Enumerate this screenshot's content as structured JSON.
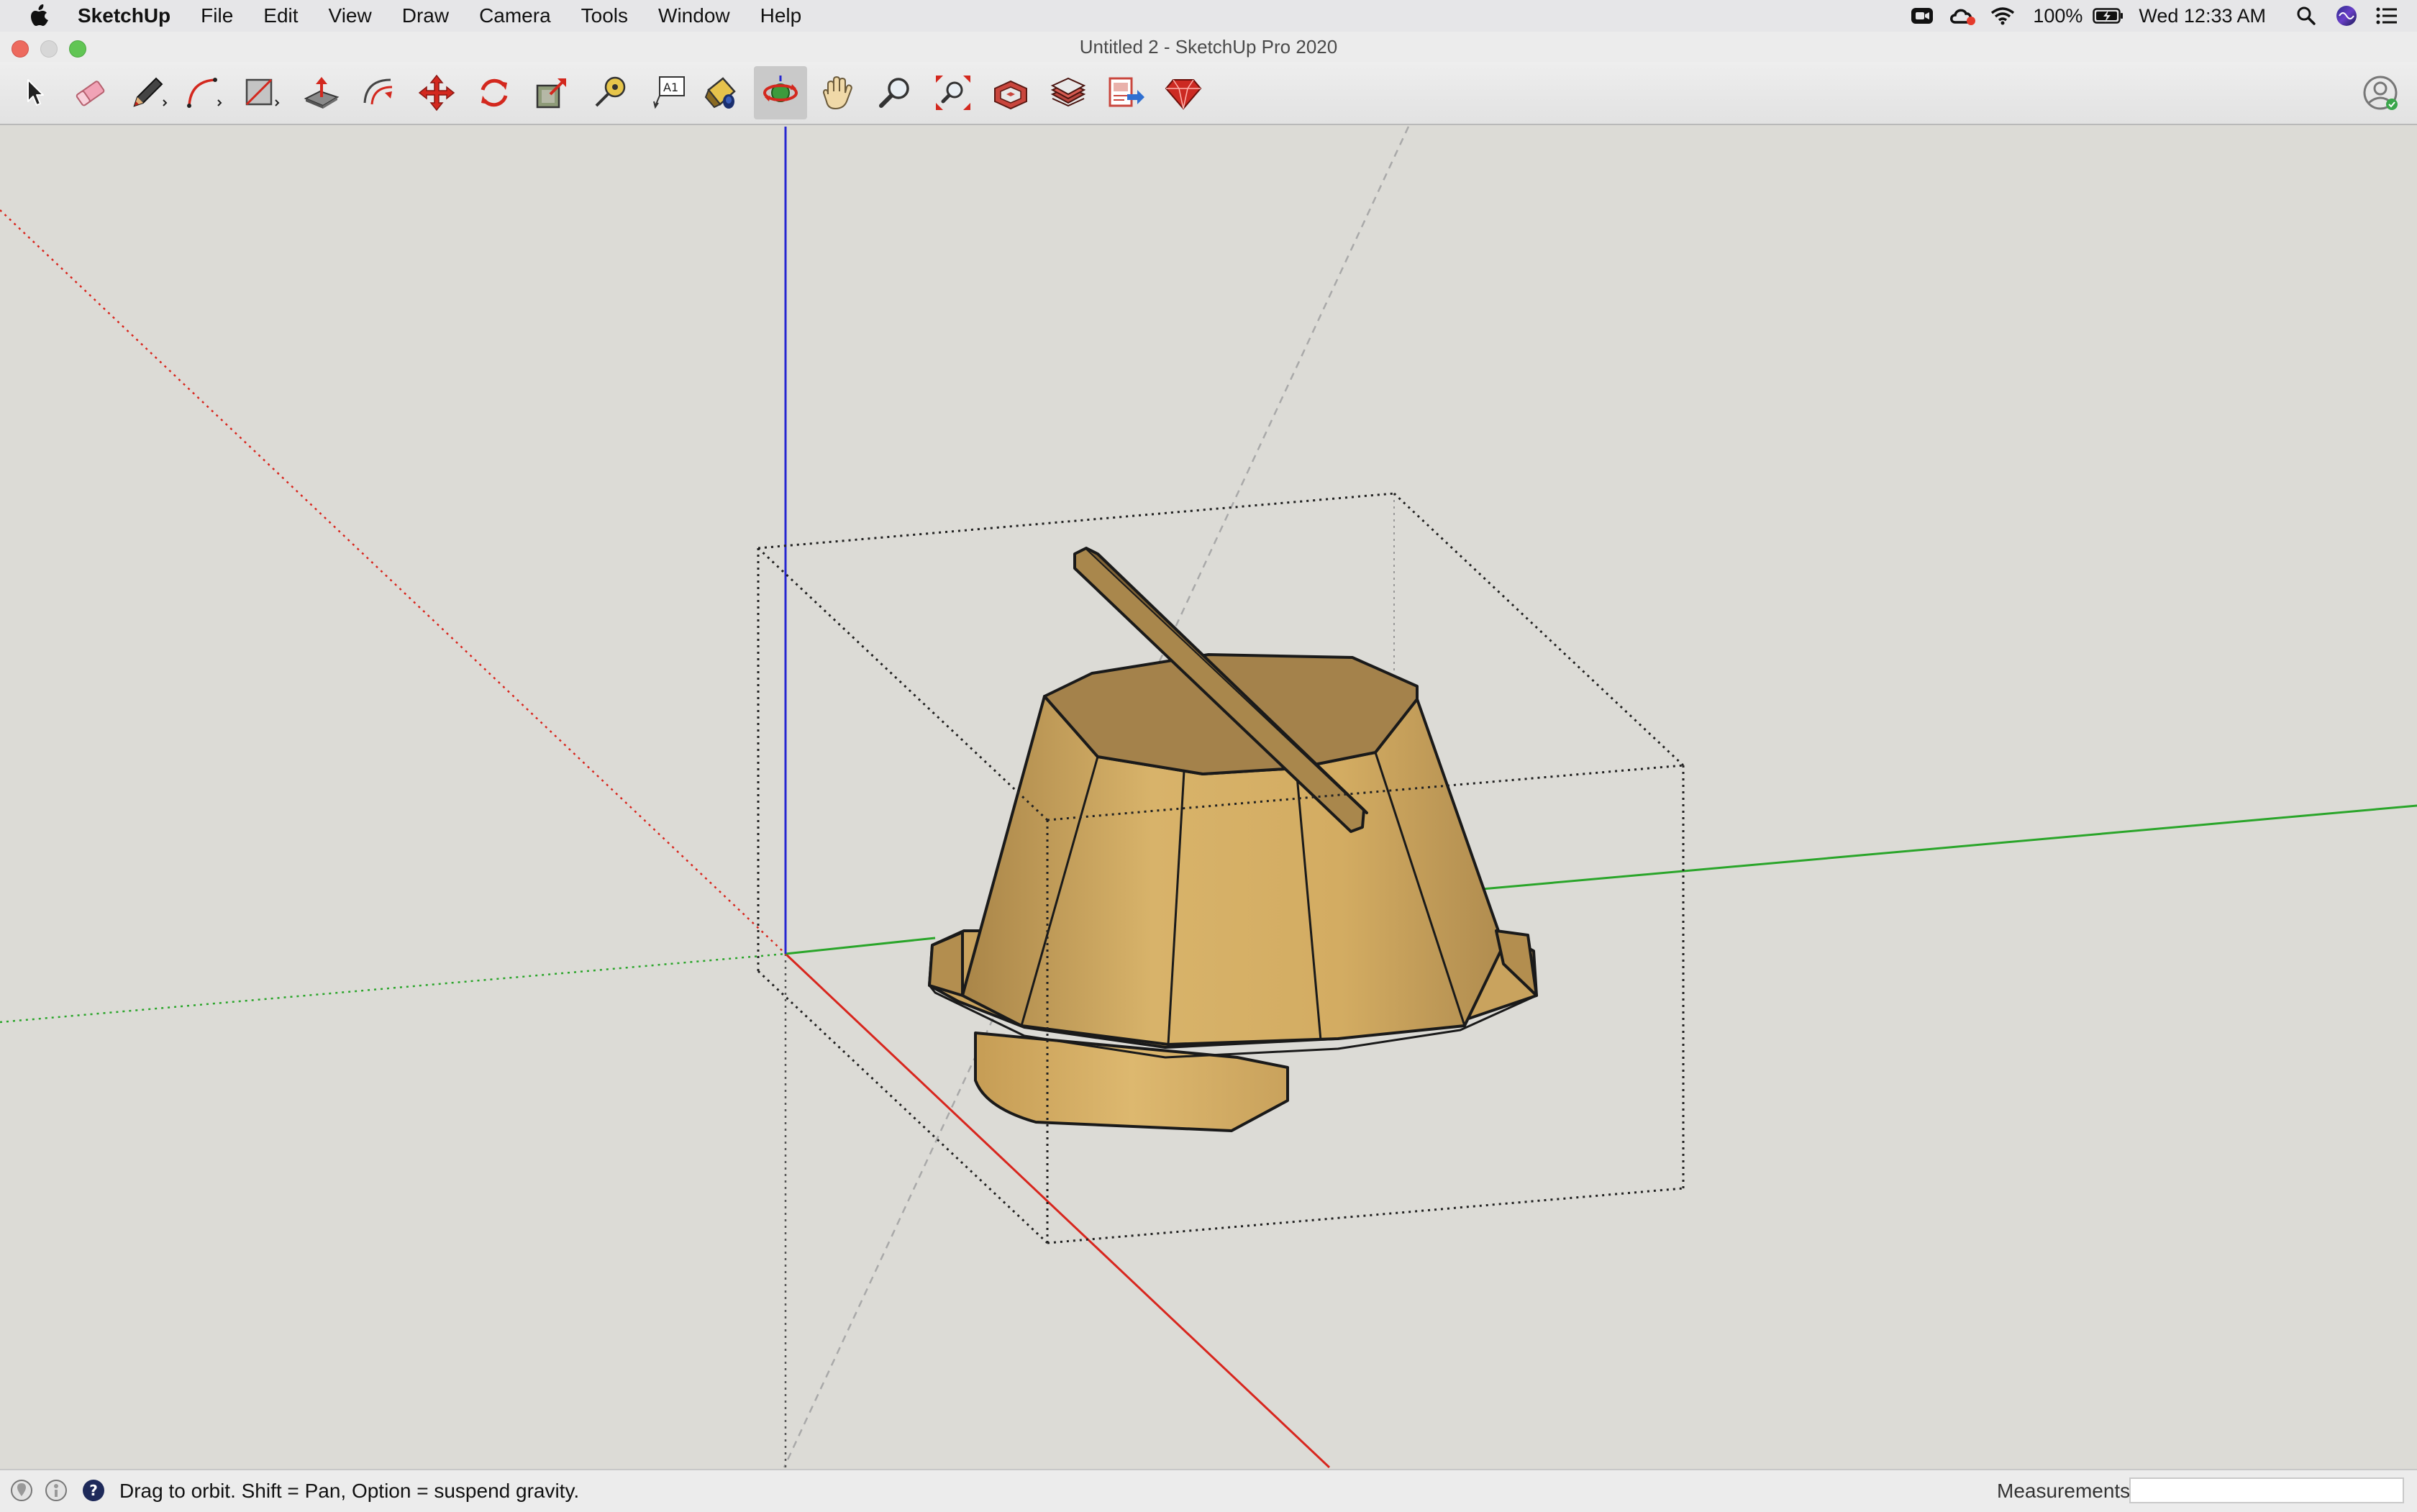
{
  "menubar": {
    "apple_icon": "apple-icon",
    "app_name": "SketchUp",
    "items": [
      "File",
      "Edit",
      "View",
      "Draw",
      "Camera",
      "Tools",
      "Window",
      "Help"
    ],
    "status": {
      "battery": "100%",
      "clock": "Wed 12:33 AM",
      "icons": [
        "zoom-icon",
        "creative-cloud-icon",
        "wifi-icon",
        "battery-icon",
        "spotlight-search-icon",
        "siri-icon",
        "control-center-icon"
      ]
    }
  },
  "window": {
    "title": "Untitled 2 - SketchUp Pro 2020"
  },
  "toolbar": {
    "tools": [
      {
        "name": "select-tool",
        "icon": "arrow-icon"
      },
      {
        "name": "eraser-tool",
        "icon": "eraser-icon"
      },
      {
        "name": "line-tool",
        "icon": "pencil-icon"
      },
      {
        "name": "arc-tool",
        "icon": "arc-icon"
      },
      {
        "name": "rectangle-tool",
        "icon": "rectangle-icon"
      },
      {
        "name": "push-pull-tool",
        "icon": "push-pull-icon"
      },
      {
        "name": "offset-tool",
        "icon": "offset-icon"
      },
      {
        "name": "move-tool",
        "icon": "move-icon"
      },
      {
        "name": "rotate-tool",
        "icon": "rotate-icon"
      },
      {
        "name": "scale-tool",
        "icon": "scale-icon"
      },
      {
        "name": "tape-measure-tool",
        "icon": "tape-measure-icon"
      },
      {
        "name": "text-tool",
        "icon": "text-icon"
      },
      {
        "name": "paint-bucket-tool",
        "icon": "paint-bucket-icon"
      },
      {
        "name": "orbit-tool",
        "icon": "orbit-icon",
        "active": true
      },
      {
        "name": "pan-tool",
        "icon": "hand-icon"
      },
      {
        "name": "zoom-tool",
        "icon": "magnifier-icon"
      },
      {
        "name": "zoom-extents-tool",
        "icon": "zoom-extents-icon"
      },
      {
        "name": "3d-warehouse-button",
        "icon": "warehouse-icon"
      },
      {
        "name": "extension-warehouse-button",
        "icon": "extension-warehouse-icon"
      },
      {
        "name": "send-to-layout-button",
        "icon": "layout-icon"
      },
      {
        "name": "ruby-console-button",
        "icon": "ruby-icon"
      }
    ],
    "text_tool_glyph": "A1",
    "account_icon": "user-account-icon"
  },
  "colors": {
    "viewport_bg": "#dcdbd6",
    "axis_red": "#d8261e",
    "axis_green": "#2aa52a",
    "axis_blue": "#2727d0",
    "wood_light": "#d8b36a",
    "wood_dark": "#a98548",
    "wood_top": "#a4824b",
    "active_tool_bg": "#c9c9c9"
  },
  "statusbar": {
    "hint": "Drag to orbit. Shift = Pan, Option = suspend gravity.",
    "measurements_label": "Measurements",
    "measurements_value": "",
    "icons": [
      "geo-location-icon",
      "credits-icon",
      "help-icon"
    ]
  }
}
